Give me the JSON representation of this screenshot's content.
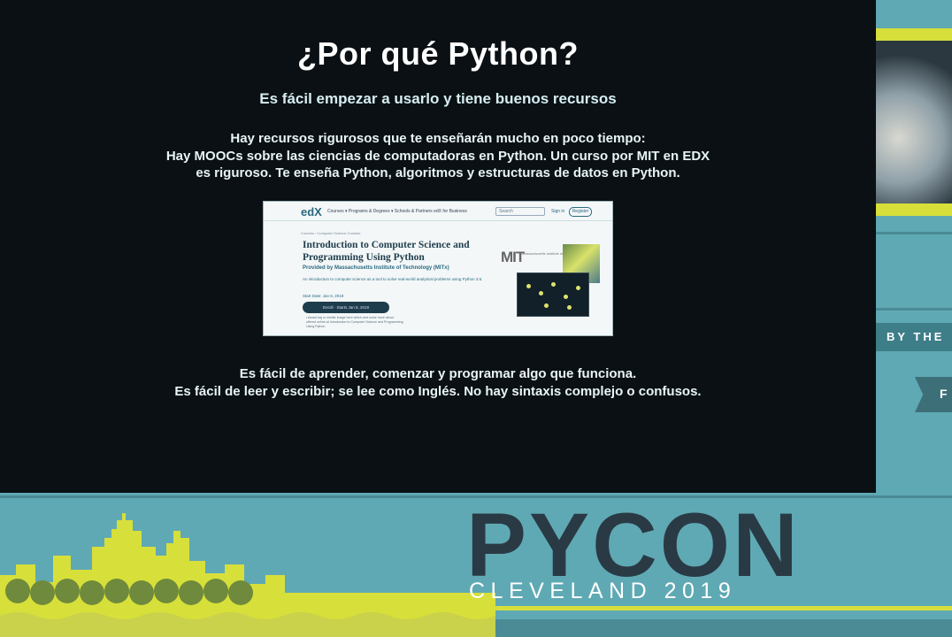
{
  "slide": {
    "title": "¿Por qué Python?",
    "subtitle": "Es fácil empezar a usarlo y tiene buenos recursos",
    "paragraph1": [
      "Hay recursos rigurosos que te enseñarán mucho en poco tiempo:",
      "Hay MOOCs sobre las ciencias de computadoras en Python. Un curso por MIT en EDX",
      "es riguroso. Te enseña Python, algoritmos y estructuras de datos en Python."
    ],
    "paragraph2": [
      "Es fácil de aprender, comenzar y programar algo que funciona.",
      "Es fácil de leer y escribir; se lee como Inglés. No hay sintaxis complejo o confusos."
    ]
  },
  "edx": {
    "logo": "edX",
    "menu": "Courses ▾   Programs & Degrees ▾   Schools & Partners   edX for Business",
    "search_placeholder": "Search",
    "signin": "Sign in",
    "register": "Register",
    "breadcrumb": "Courses  ›  Computer Science Courses",
    "course_title": "Introduction to Computer Science and Programming Using Python",
    "provider": "Provided by Massachusetts Institute of Technology (MITx)",
    "description": "An introduction to computer science as a tool to solve real-world analytical problems using Python 3.5.",
    "start_date": "Start Date: Jan 8, 2019",
    "enroll": "Enroll · Starts Jan 8, 2019",
    "bullets": "• Award tag or similar image here which and some more about offered online at Introduction to Computer Science and Programming Using Python",
    "mit_logo": "MIT",
    "mit_sub": "Massachusetts Institute of Technology"
  },
  "sidebar": {
    "by_text": "BY THE",
    "flag_text": "F"
  },
  "branding": {
    "event": "PYCON",
    "location": "CLEVELAND 2019"
  },
  "colors": {
    "background": "#5fa9b4",
    "slide_bg": "#0a1014",
    "accent_yellow": "#d7df3a",
    "pycon_dark": "#2a3a44"
  }
}
